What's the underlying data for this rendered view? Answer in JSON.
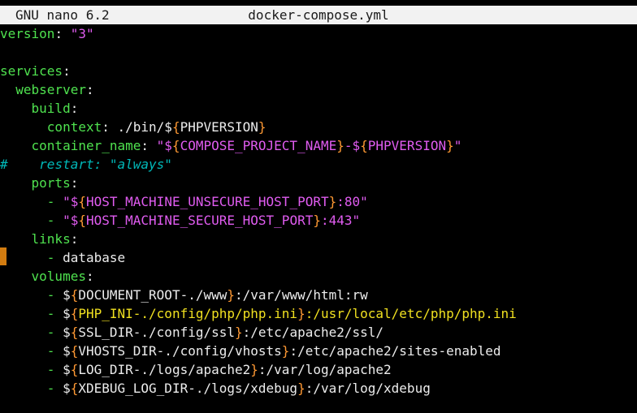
{
  "titlebar": {
    "app": "GNU nano 6.2",
    "filename": "docker-compose.yml"
  },
  "colors": {
    "key": "#4fe24f",
    "plain": "#ececec",
    "string": "#e05cf0",
    "brace": "#ff9933",
    "highlight": "#f0e020",
    "comment": "#00b8b8",
    "cursor": "#d27c10"
  },
  "lines": [
    [
      [
        "g",
        "version"
      ],
      [
        "w",
        ": "
      ],
      [
        "m",
        "\"3\""
      ]
    ],
    [],
    [
      [
        "g",
        "services"
      ],
      [
        "w",
        ":"
      ]
    ],
    [
      [
        "w",
        "  "
      ],
      [
        "g",
        "webserver"
      ],
      [
        "w",
        ":"
      ]
    ],
    [
      [
        "w",
        "    "
      ],
      [
        "g",
        "build"
      ],
      [
        "w",
        ":"
      ]
    ],
    [
      [
        "w",
        "      "
      ],
      [
        "g",
        "context"
      ],
      [
        "w",
        ": ./bin/$"
      ],
      [
        "o",
        "{"
      ],
      [
        "w",
        "PHPVERSION"
      ],
      [
        "o",
        "}"
      ]
    ],
    [
      [
        "w",
        "    "
      ],
      [
        "g",
        "container_name"
      ],
      [
        "w",
        ": "
      ],
      [
        "m",
        "\"$"
      ],
      [
        "o",
        "{"
      ],
      [
        "m",
        "COMPOSE_PROJECT_NAME"
      ],
      [
        "o",
        "}"
      ],
      [
        "m",
        "-$"
      ],
      [
        "o",
        "{"
      ],
      [
        "m",
        "PHPVERSION"
      ],
      [
        "o",
        "}"
      ],
      [
        "m",
        "\""
      ]
    ],
    [
      [
        "k",
        "#"
      ],
      [
        "w",
        "    "
      ],
      [
        "c",
        "restart: \"always\""
      ]
    ],
    [
      [
        "w",
        "    "
      ],
      [
        "g",
        "ports"
      ],
      [
        "w",
        ":"
      ]
    ],
    [
      [
        "w",
        "      "
      ],
      [
        "g",
        "-"
      ],
      [
        "w",
        " "
      ],
      [
        "m",
        "\"$"
      ],
      [
        "o",
        "{"
      ],
      [
        "m",
        "HOST_MACHINE_UNSECURE_HOST_PORT"
      ],
      [
        "o",
        "}"
      ],
      [
        "m",
        ":80\""
      ]
    ],
    [
      [
        "w",
        "      "
      ],
      [
        "g",
        "-"
      ],
      [
        "w",
        " "
      ],
      [
        "m",
        "\"$"
      ],
      [
        "o",
        "{"
      ],
      [
        "m",
        "HOST_MACHINE_SECURE_HOST_PORT"
      ],
      [
        "o",
        "}"
      ],
      [
        "m",
        ":443\""
      ]
    ],
    [
      [
        "w",
        "    "
      ],
      [
        "g",
        "links"
      ],
      [
        "w",
        ":"
      ]
    ],
    [
      [
        "w",
        "      "
      ],
      [
        "g",
        "-"
      ],
      [
        "w",
        " database"
      ]
    ],
    [
      [
        "w",
        "    "
      ],
      [
        "g",
        "volumes"
      ],
      [
        "w",
        ":"
      ]
    ],
    [
      [
        "w",
        "      "
      ],
      [
        "g",
        "-"
      ],
      [
        "w",
        " $"
      ],
      [
        "o",
        "{"
      ],
      [
        "w",
        "DOCUMENT_ROOT-./www"
      ],
      [
        "o",
        "}"
      ],
      [
        "w",
        ":/var/www/html:rw"
      ]
    ],
    [
      [
        "w",
        "      "
      ],
      [
        "g",
        "-"
      ],
      [
        "w",
        " $"
      ],
      [
        "o",
        "{"
      ],
      [
        "y",
        "PHP_INI-./config/php/php.ini"
      ],
      [
        "o",
        "}"
      ],
      [
        "y",
        ":/usr/local/etc/php/php.ini"
      ]
    ],
    [
      [
        "w",
        "      "
      ],
      [
        "g",
        "-"
      ],
      [
        "w",
        " $"
      ],
      [
        "o",
        "{"
      ],
      [
        "w",
        "SSL_DIR-./config/ssl"
      ],
      [
        "o",
        "}"
      ],
      [
        "w",
        ":/etc/apache2/ssl/"
      ]
    ],
    [
      [
        "w",
        "      "
      ],
      [
        "g",
        "-"
      ],
      [
        "w",
        " $"
      ],
      [
        "o",
        "{"
      ],
      [
        "w",
        "VHOSTS_DIR-./config/vhosts"
      ],
      [
        "o",
        "}"
      ],
      [
        "w",
        ":/etc/apache2/sites-enabled"
      ]
    ],
    [
      [
        "w",
        "      "
      ],
      [
        "g",
        "-"
      ],
      [
        "w",
        " $"
      ],
      [
        "o",
        "{"
      ],
      [
        "w",
        "LOG_DIR-./logs/apache2"
      ],
      [
        "o",
        "}"
      ],
      [
        "w",
        ":/var/log/apache2"
      ]
    ],
    [
      [
        "w",
        "      "
      ],
      [
        "g",
        "-"
      ],
      [
        "w",
        " $"
      ],
      [
        "o",
        "{"
      ],
      [
        "w",
        "XDEBUG_LOG_DIR-./logs/xdebug"
      ],
      [
        "o",
        "}"
      ],
      [
        "w",
        ":/var/log/xdebug"
      ]
    ]
  ]
}
